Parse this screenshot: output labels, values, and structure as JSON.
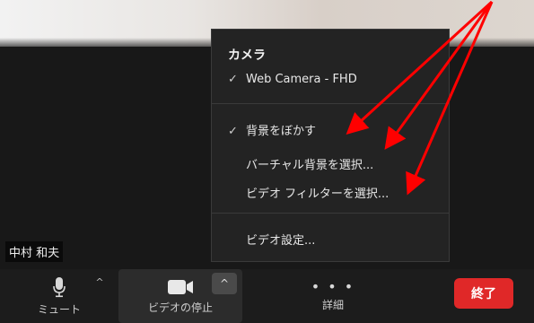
{
  "participant": {
    "name": "中村 和夫"
  },
  "camera_menu": {
    "heading": "カメラ",
    "camera_item": "Web Camera - FHD",
    "blur_item": "背景をぼかす",
    "virtual_bg_item": "バーチャル背景を選択...",
    "video_filter_item": "ビデオ フィルターを選択...",
    "video_settings_item": "ビデオ設定...",
    "check_mark": "✓"
  },
  "toolbar": {
    "mute_label": "ミュート",
    "video_stop_label": "ビデオの停止",
    "details_label": "詳細",
    "details_dots": "• • •",
    "caret": "^",
    "end_label": "終了"
  },
  "colors": {
    "annotation_arrow": "#ff0000",
    "end_button": "#e02828"
  },
  "icons": [
    "microphone-icon",
    "video-camera-icon",
    "more-dots-icon",
    "checkmark-icon",
    "caret-up-icon"
  ]
}
